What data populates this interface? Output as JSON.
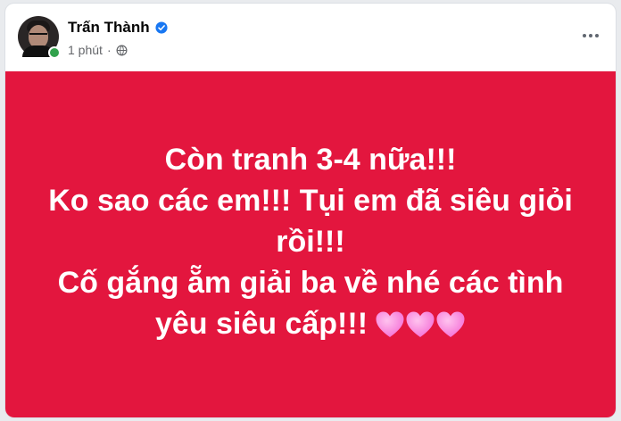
{
  "post": {
    "author": "Trấn Thành",
    "time": "1 phút",
    "verified": true,
    "privacy_icon": "globe-icon",
    "more_icon": "more-horizontal-icon",
    "background_color": "#e3163e",
    "text_lines": [
      "Còn tranh 3-4 nữa!!!",
      "Ko sao các em!!! Tụi em đã siêu giỏi",
      "rồi!!!",
      "Cố gắng ẵm giải ba về nhé các tình",
      "yêu siêu cấp!!!"
    ],
    "emoji": [
      "pink-heart-icon",
      "pink-heart-icon",
      "pink-heart-icon"
    ]
  }
}
